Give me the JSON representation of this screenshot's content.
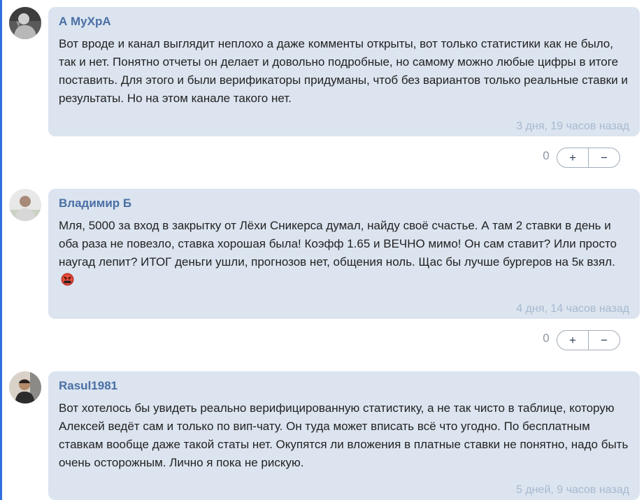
{
  "comments": [
    {
      "author": "А МуХрА",
      "text": "Вот вроде и канал выглядит неплохо а даже комменты открыты, вот только статистики как не было, так и нет. Понятно отчеты он делает и довольно подробные, но самому можно любые цифры в итоге поставить. Для этого и были верификаторы придуманы, чтоб без вариантов только реальные ставки и результаты. Но на этом канале такого нет.",
      "time": "3 дня, 19 часов назад",
      "score": "0",
      "upvote": "+",
      "downvote": "−"
    },
    {
      "author": "Владимир Б",
      "text": "Мля, 5000 за вход в закрытку от Лёхи Сникерса думал, найду своё счастье. А там 2 ставки в день и оба раза не повезло, ставка хорошая была! Коэфф 1.65 и ВЕЧНО мимо! Он сам ставит? Или просто наугад лепит? ИТОГ деньги ушли, прогнозов нет, общения ноль. Щас бы лучше бургеров на 5к взял.",
      "emoji": "angry-face-emoji",
      "time": "4 дня, 14 часов назад",
      "score": "0",
      "upvote": "+",
      "downvote": "−"
    },
    {
      "author": "Rasul1981",
      "text": "Вот хотелось бы увидеть реально верифицированную статистику, а не так чисто в таблице, которую Алексей ведёт сам и только по вип-чату. Он туда может вписать всё что угодно. По бесплатным ставкам вообще даже такой статы нет. Окупятся ли вложения в платные ставки не понятно, надо быть очень осторожным. Лично я пока не рискую.",
      "time": "5 дней, 9 часов назад"
    }
  ],
  "colors": {
    "bubble": "#dbe4ef",
    "author": "#4a6fa5",
    "timestamp": "#a8b9cf",
    "accent_rule": "#2f6fe0"
  }
}
